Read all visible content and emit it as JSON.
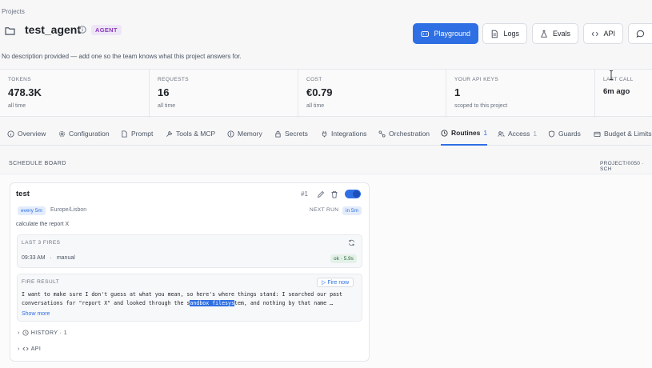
{
  "breadcrumb": "Projects",
  "project": {
    "title": "test_agent",
    "badge": "AGENT",
    "description": "No description provided — add one so the team knows what this project answers for."
  },
  "toolbar": {
    "playground": "Playground",
    "logs": "Logs",
    "evals": "Evals",
    "api": "API"
  },
  "stats": [
    {
      "label": "TOKENS",
      "value": "478.3K",
      "sub": "all time"
    },
    {
      "label": "REQUESTS",
      "value": "16",
      "sub": "all time"
    },
    {
      "label": "COST",
      "value": "€0.79",
      "sub": "all time"
    },
    {
      "label": "YOUR API KEYS",
      "value": "1",
      "sub": "scoped to this project"
    },
    {
      "label": "LAST CALL",
      "value": "6m ago",
      "sub": ""
    }
  ],
  "tabs": [
    {
      "label": "Overview",
      "icon": "info-icon"
    },
    {
      "label": "Configuration",
      "icon": "gear-icon"
    },
    {
      "label": "Prompt",
      "icon": "document-icon"
    },
    {
      "label": "Tools & MCP",
      "icon": "wrench-icon"
    },
    {
      "label": "Memory",
      "icon": "memory-icon"
    },
    {
      "label": "Secrets",
      "icon": "lock-icon"
    },
    {
      "label": "Integrations",
      "icon": "plug-icon"
    },
    {
      "label": "Orchestration",
      "icon": "nodes-icon"
    },
    {
      "label": "Routines",
      "icon": "clock-icon",
      "count": "1",
      "active": true
    },
    {
      "label": "Access",
      "icon": "users-icon",
      "count": "1"
    },
    {
      "label": "Guards",
      "icon": "shield-icon"
    },
    {
      "label": "Budget & Limits",
      "icon": "wallet-icon"
    }
  ],
  "schedule_board": {
    "label": "SCHEDULE BOARD",
    "code": "PROJECT/0050 · SCH"
  },
  "routine": {
    "name": "test",
    "number": "#1",
    "enabled": true,
    "frequency": "every 5m",
    "timezone": "Europe/Lisbon",
    "next_run_label": "NEXT RUN",
    "next_run": "in 5m",
    "description": "calculate the report X",
    "last_fires": {
      "label": "LAST 3 FIRES",
      "time": "09:33 AM",
      "separator": "·",
      "trigger": "manual",
      "status": "ok · 5.9s"
    },
    "fire_result": {
      "label": "FIRE RESULT",
      "fire_now": "▷ Fire now",
      "line1": "I want to make sure I don't guess at what you mean, so here's where things stand: I searched our past",
      "line2_before": "conversations for \"report X\" and looked through the s",
      "line2_highlight": "andbox filesys",
      "line2_after": "tem, and nothing by that name …",
      "show_more": "Show more"
    },
    "history": "HISTORY · 1",
    "api": "API"
  },
  "colors": {
    "accent": "#2f6fe4",
    "badge_bg": "#eee6f7",
    "badge_text": "#8a3ab9",
    "ok_bg": "#e4f1e8"
  }
}
